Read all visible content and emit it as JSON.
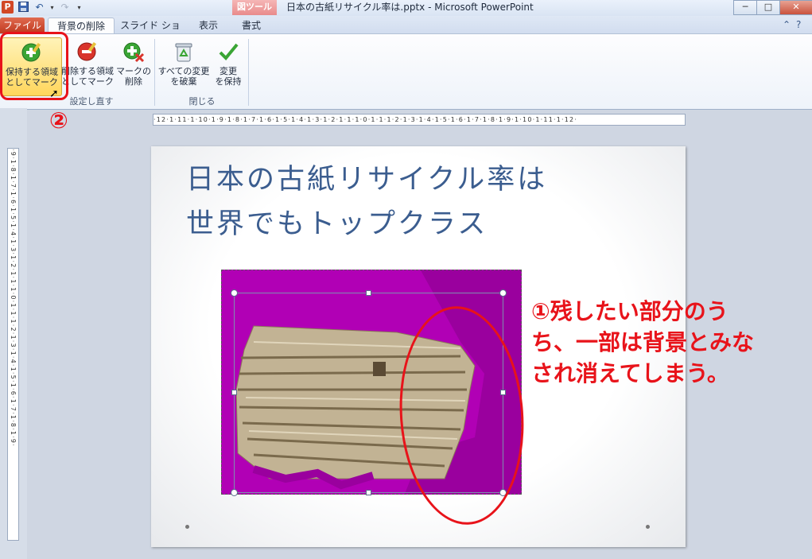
{
  "window": {
    "title": "日本の古紙リサイクル率は.pptx  -  Microsoft PowerPoint",
    "app_icon": "P",
    "context_tool_label": "図ツール",
    "controls": {
      "minimize": "─",
      "maximize": "□",
      "close": "✕"
    }
  },
  "qat": {
    "save": "save-icon",
    "undo": "undo-icon",
    "redo": "redo-icon",
    "customize": "dropdown-icon"
  },
  "tabs": {
    "file": "ファイル",
    "remove_bg": "背景の削除",
    "slideshow": "スライド ショー",
    "view": "表示",
    "format": "書式"
  },
  "ribbon": {
    "mark_keep": "保持する領域としてマーク",
    "mark_keep_l1": "保持する領域",
    "mark_keep_l2": "としてマーク",
    "mark_remove_l1": "削除する領域",
    "mark_remove_l2": "としてマーク",
    "delete_mark_l1": "マークの",
    "delete_mark_l2": "削除",
    "discard_l1": "すべての変更",
    "discard_l2": "を破棄",
    "keep_changes_l1": "変更",
    "keep_changes_l2": "を保持",
    "group_refine": "設定し直す",
    "group_close": "閉じる"
  },
  "ruler": {
    "horizontal": "·12·1·11·1·10·1·9·1·8·1·7·1·6·1·5·1·4·1·3·1·2·1·1·1·0·1·1·1·2·1·3·1·4·1·5·1·6·1·7·1·8·1·9·1·10·1·11·1·12·",
    "vertical": "·9·1·8·1·7·1·6·1·5·1·4·1·3·1·2·1·1·1·0·1·1·1·2·1·3·1·4·1·5·1·6·1·7·1·8·1·9·"
  },
  "slide": {
    "title_line1": "日本の古紙リサイクル率は",
    "title_line2": "世界でもトップクラス"
  },
  "annotations": {
    "step2": "②",
    "note_line1": "①残したい部分のう",
    "note_line2": "ち、一部は背景とみな",
    "note_line3": "され消えてしまう。",
    "color": "#e8131a"
  },
  "colors": {
    "removed_area": "#b100b5",
    "title_text": "#3b5d8f"
  }
}
